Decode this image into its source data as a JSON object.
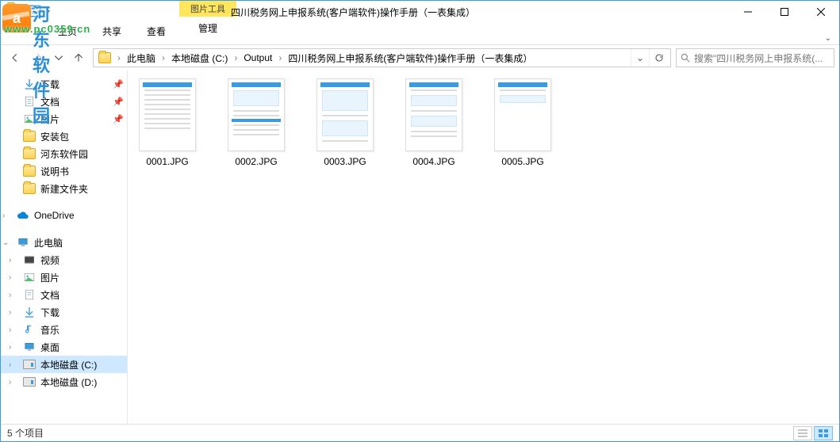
{
  "window": {
    "title": "四川税务网上申报系统(客户端软件)操作手册（一表集成）",
    "context_tab_header": "图片工具",
    "context_tab_label": "管理",
    "tabs": {
      "file": "文件",
      "home": "主页",
      "share": "共享",
      "view": "查看"
    }
  },
  "watermark": {
    "brand": "河东软件园",
    "url": "www.pc0359.cn"
  },
  "breadcrumb": {
    "pc": "此电脑",
    "drive": "本地磁盘 (C:)",
    "output": "Output",
    "folder": "四川税务网上申报系统(客户端软件)操作手册（一表集成）"
  },
  "search": {
    "placeholder": "搜索\"四川税务网上申报系统(..."
  },
  "sidebar": {
    "downloads": "下载",
    "documents": "文档",
    "pictures": "图片",
    "pkg": "安装包",
    "hedong": "河东软件园",
    "manual": "说明书",
    "newfolder": "新建文件夹",
    "onedrive": "OneDrive",
    "thispc": "此电脑",
    "videos": "视频",
    "pictures2": "图片",
    "documents2": "文档",
    "downloads2": "下载",
    "music": "音乐",
    "desktop": "桌面",
    "driveC": "本地磁盘 (C:)",
    "driveD": "本地磁盘 (D:)"
  },
  "files": {
    "f1": "0001.JPG",
    "f2": "0002.JPG",
    "f3": "0003.JPG",
    "f4": "0004.JPG",
    "f5": "0005.JPG"
  },
  "status": {
    "count": "5 个项目"
  }
}
